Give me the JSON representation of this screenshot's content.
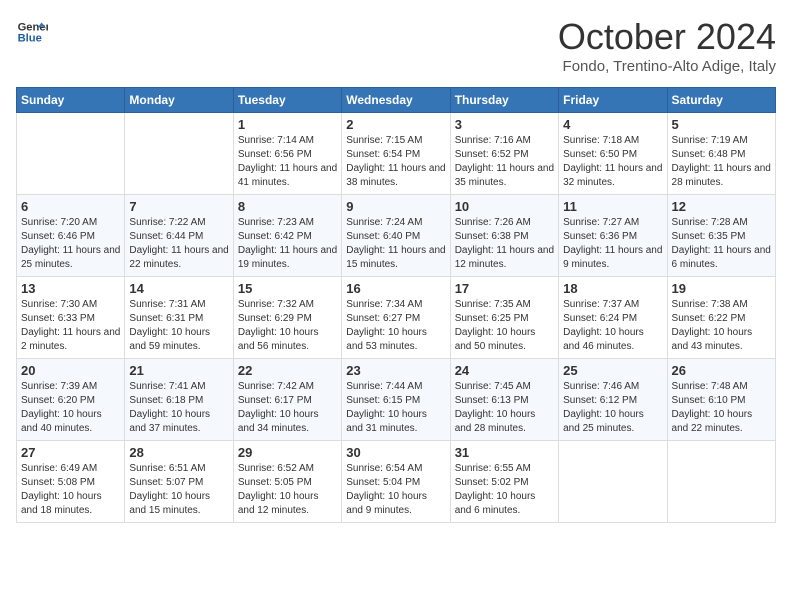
{
  "header": {
    "logo_line1": "General",
    "logo_line2": "Blue",
    "month_title": "October 2024",
    "subtitle": "Fondo, Trentino-Alto Adige, Italy"
  },
  "days_of_week": [
    "Sunday",
    "Monday",
    "Tuesday",
    "Wednesday",
    "Thursday",
    "Friday",
    "Saturday"
  ],
  "weeks": [
    [
      {
        "day": "",
        "info": ""
      },
      {
        "day": "",
        "info": ""
      },
      {
        "day": "1",
        "info": "Sunrise: 7:14 AM\nSunset: 6:56 PM\nDaylight: 11 hours and 41 minutes."
      },
      {
        "day": "2",
        "info": "Sunrise: 7:15 AM\nSunset: 6:54 PM\nDaylight: 11 hours and 38 minutes."
      },
      {
        "day": "3",
        "info": "Sunrise: 7:16 AM\nSunset: 6:52 PM\nDaylight: 11 hours and 35 minutes."
      },
      {
        "day": "4",
        "info": "Sunrise: 7:18 AM\nSunset: 6:50 PM\nDaylight: 11 hours and 32 minutes."
      },
      {
        "day": "5",
        "info": "Sunrise: 7:19 AM\nSunset: 6:48 PM\nDaylight: 11 hours and 28 minutes."
      }
    ],
    [
      {
        "day": "6",
        "info": "Sunrise: 7:20 AM\nSunset: 6:46 PM\nDaylight: 11 hours and 25 minutes."
      },
      {
        "day": "7",
        "info": "Sunrise: 7:22 AM\nSunset: 6:44 PM\nDaylight: 11 hours and 22 minutes."
      },
      {
        "day": "8",
        "info": "Sunrise: 7:23 AM\nSunset: 6:42 PM\nDaylight: 11 hours and 19 minutes."
      },
      {
        "day": "9",
        "info": "Sunrise: 7:24 AM\nSunset: 6:40 PM\nDaylight: 11 hours and 15 minutes."
      },
      {
        "day": "10",
        "info": "Sunrise: 7:26 AM\nSunset: 6:38 PM\nDaylight: 11 hours and 12 minutes."
      },
      {
        "day": "11",
        "info": "Sunrise: 7:27 AM\nSunset: 6:36 PM\nDaylight: 11 hours and 9 minutes."
      },
      {
        "day": "12",
        "info": "Sunrise: 7:28 AM\nSunset: 6:35 PM\nDaylight: 11 hours and 6 minutes."
      }
    ],
    [
      {
        "day": "13",
        "info": "Sunrise: 7:30 AM\nSunset: 6:33 PM\nDaylight: 11 hours and 2 minutes."
      },
      {
        "day": "14",
        "info": "Sunrise: 7:31 AM\nSunset: 6:31 PM\nDaylight: 10 hours and 59 minutes."
      },
      {
        "day": "15",
        "info": "Sunrise: 7:32 AM\nSunset: 6:29 PM\nDaylight: 10 hours and 56 minutes."
      },
      {
        "day": "16",
        "info": "Sunrise: 7:34 AM\nSunset: 6:27 PM\nDaylight: 10 hours and 53 minutes."
      },
      {
        "day": "17",
        "info": "Sunrise: 7:35 AM\nSunset: 6:25 PM\nDaylight: 10 hours and 50 minutes."
      },
      {
        "day": "18",
        "info": "Sunrise: 7:37 AM\nSunset: 6:24 PM\nDaylight: 10 hours and 46 minutes."
      },
      {
        "day": "19",
        "info": "Sunrise: 7:38 AM\nSunset: 6:22 PM\nDaylight: 10 hours and 43 minutes."
      }
    ],
    [
      {
        "day": "20",
        "info": "Sunrise: 7:39 AM\nSunset: 6:20 PM\nDaylight: 10 hours and 40 minutes."
      },
      {
        "day": "21",
        "info": "Sunrise: 7:41 AM\nSunset: 6:18 PM\nDaylight: 10 hours and 37 minutes."
      },
      {
        "day": "22",
        "info": "Sunrise: 7:42 AM\nSunset: 6:17 PM\nDaylight: 10 hours and 34 minutes."
      },
      {
        "day": "23",
        "info": "Sunrise: 7:44 AM\nSunset: 6:15 PM\nDaylight: 10 hours and 31 minutes."
      },
      {
        "day": "24",
        "info": "Sunrise: 7:45 AM\nSunset: 6:13 PM\nDaylight: 10 hours and 28 minutes."
      },
      {
        "day": "25",
        "info": "Sunrise: 7:46 AM\nSunset: 6:12 PM\nDaylight: 10 hours and 25 minutes."
      },
      {
        "day": "26",
        "info": "Sunrise: 7:48 AM\nSunset: 6:10 PM\nDaylight: 10 hours and 22 minutes."
      }
    ],
    [
      {
        "day": "27",
        "info": "Sunrise: 6:49 AM\nSunset: 5:08 PM\nDaylight: 10 hours and 18 minutes."
      },
      {
        "day": "28",
        "info": "Sunrise: 6:51 AM\nSunset: 5:07 PM\nDaylight: 10 hours and 15 minutes."
      },
      {
        "day": "29",
        "info": "Sunrise: 6:52 AM\nSunset: 5:05 PM\nDaylight: 10 hours and 12 minutes."
      },
      {
        "day": "30",
        "info": "Sunrise: 6:54 AM\nSunset: 5:04 PM\nDaylight: 10 hours and 9 minutes."
      },
      {
        "day": "31",
        "info": "Sunrise: 6:55 AM\nSunset: 5:02 PM\nDaylight: 10 hours and 6 minutes."
      },
      {
        "day": "",
        "info": ""
      },
      {
        "day": "",
        "info": ""
      }
    ]
  ]
}
